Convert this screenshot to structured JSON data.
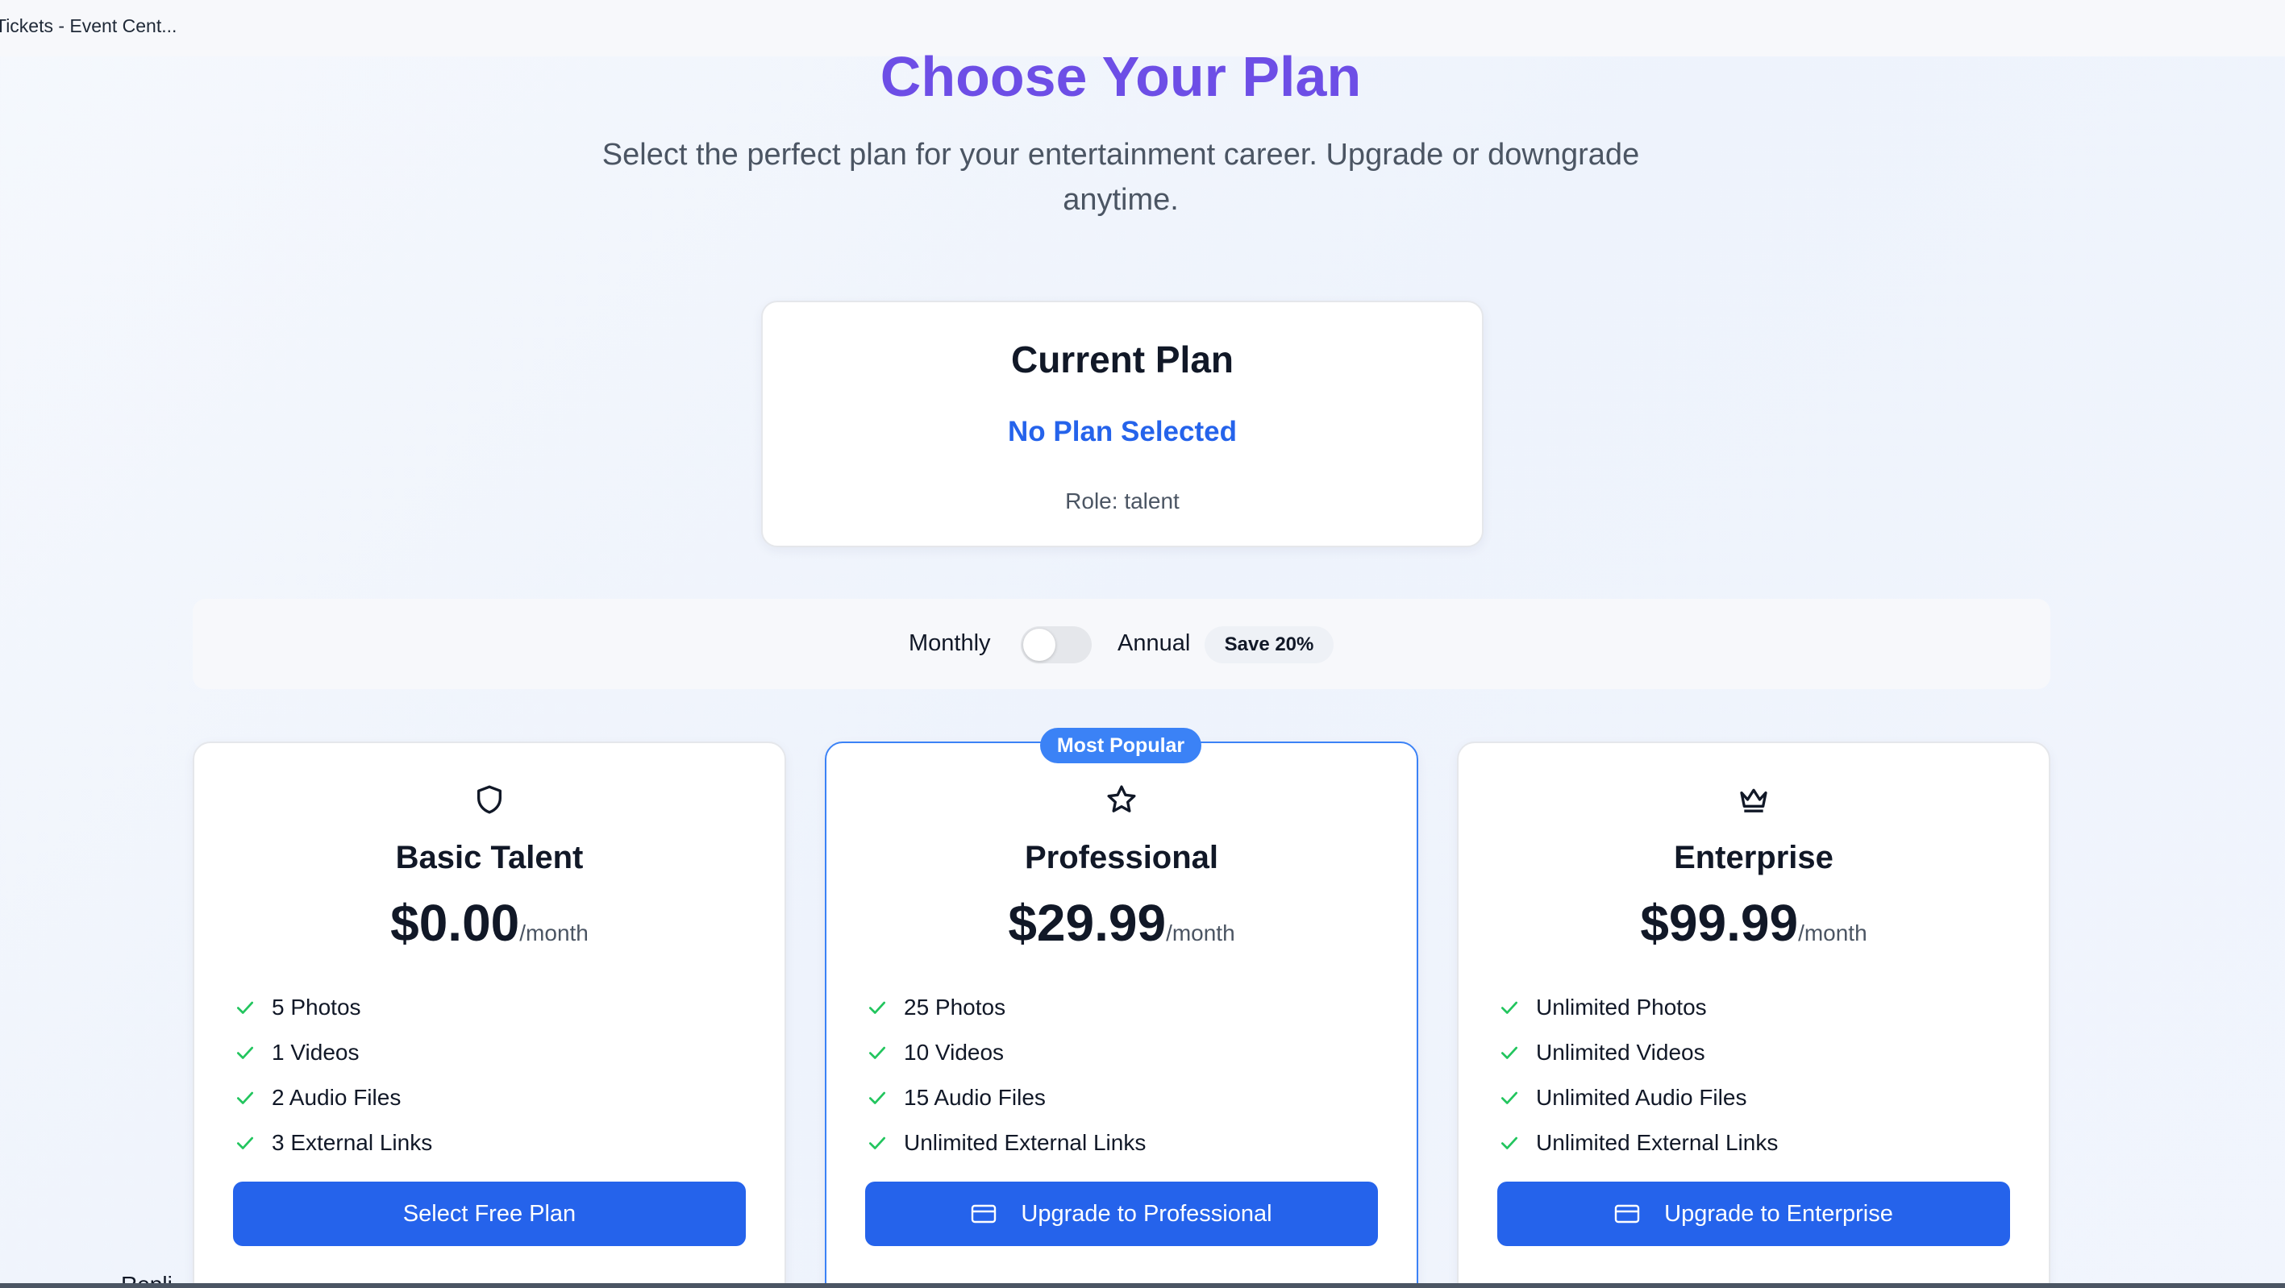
{
  "window": {
    "title": "Tickets - Event Cent..."
  },
  "header": {
    "title": "Choose Your Plan",
    "subtitle": "Select the perfect plan for your entertainment career. Upgrade or downgrade anytime."
  },
  "current_plan": {
    "heading": "Current Plan",
    "plan": "No Plan Selected",
    "role": "Role: talent"
  },
  "billing": {
    "monthly_label": "Monthly",
    "annual_label": "Annual",
    "save_badge": "Save 20%",
    "annual_enabled": false
  },
  "plans": [
    {
      "icon": "shield-icon",
      "name": "Basic Talent",
      "price": "$0.00",
      "period": "/month",
      "features": [
        "5 Photos",
        "1 Videos",
        "2 Audio Files",
        "3 External Links"
      ],
      "cta": "Select Free Plan"
    },
    {
      "icon": "star-icon",
      "badge": "Most Popular",
      "name": "Professional",
      "price": "$29.99",
      "period": "/month",
      "features": [
        "25 Photos",
        "10 Videos",
        "15 Audio Files",
        "Unlimited External Links"
      ],
      "cta": "Upgrade to Professional"
    },
    {
      "icon": "crown-icon",
      "name": "Enterprise",
      "price": "$99.99",
      "period": "/month",
      "features": [
        "Unlimited Photos",
        "Unlimited Videos",
        "Unlimited Audio Files",
        "Unlimited External Links"
      ],
      "cta": "Upgrade to Enterprise"
    }
  ],
  "colors": {
    "heading": "#6d4ee6",
    "accent": "#2563eb",
    "badge": "#3b82f6",
    "check": "#22c55e"
  },
  "footer_cutoff_text": "Repli"
}
